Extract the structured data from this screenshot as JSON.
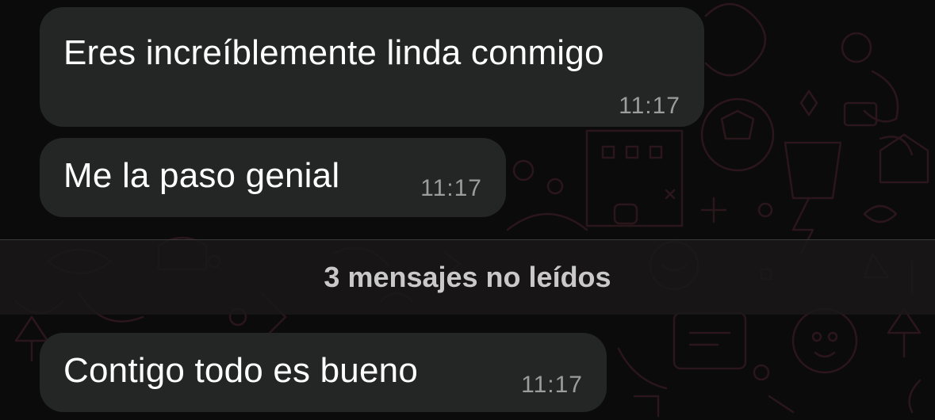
{
  "messages": [
    {
      "text": "Eres increíblemente linda conmigo",
      "time": "11:17"
    },
    {
      "text": "Me la paso genial",
      "time": "11:17"
    },
    {
      "text": "Contigo todo es bueno",
      "time": "11:17"
    }
  ],
  "unread_divider": {
    "label": "3 mensajes no leídos"
  },
  "colors": {
    "background": "#0b0b0b",
    "bubble": "#242626",
    "text": "#ffffff",
    "timestamp": "#9a9d9c",
    "wallpaper_doodles": "#2a151b"
  }
}
